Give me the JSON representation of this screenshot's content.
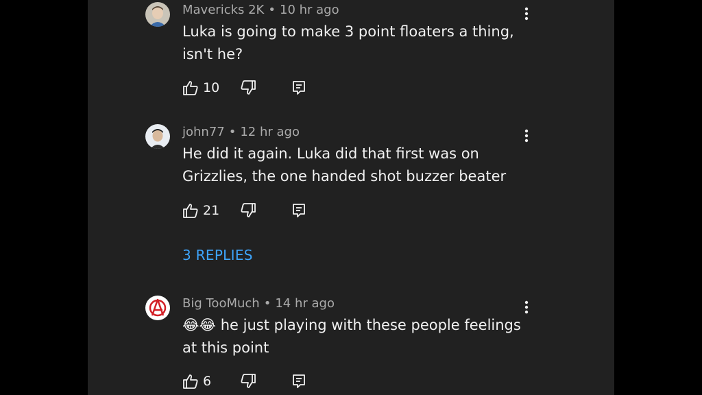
{
  "comments": [
    {
      "author": "Mavericks 2K",
      "separator": "•",
      "time": "10 hr ago",
      "text": "Luka is going to make 3 point floaters a thing, isn't he?",
      "likes": "10"
    },
    {
      "author": "john77",
      "separator": "•",
      "time": "12 hr ago",
      "text": "He did it again. Luka did that first was on Grizzlies, the one handed shot buzzer beater",
      "likes": "21"
    },
    {
      "author": "Big TooMuch",
      "separator": "•",
      "time": "14 hr ago",
      "text": "😂😂 he just playing with these people feelings at this point",
      "likes": "6"
    }
  ],
  "replies_link": "3 REPLIES",
  "icons": {
    "like": "thumbs-up-icon",
    "dislike": "thumbs-down-icon",
    "reply": "comment-reply-icon",
    "menu": "vertical-dots-icon"
  },
  "colors": {
    "background": "#212121",
    "text": "#f1f1f1",
    "meta": "#aaaaaa",
    "link": "#3ea6ff"
  }
}
